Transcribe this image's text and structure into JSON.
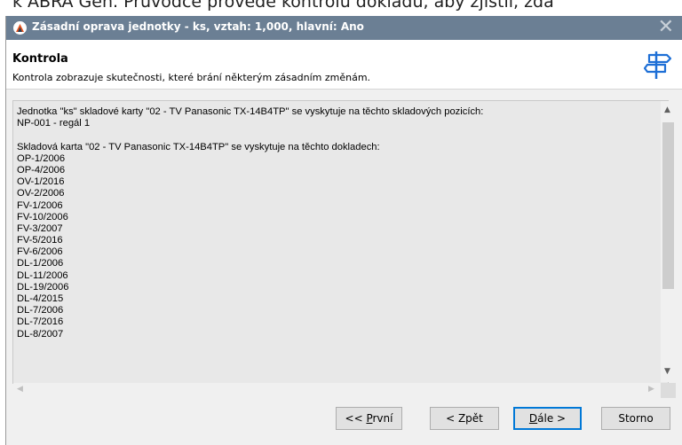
{
  "background_text": "k ABRA Gen. Průvodce provede kontrolu dokladu, aby zjistil, zda",
  "window": {
    "title": "Zásadní oprava jednotky - ks, vztah: 1,000, hlavní: Ano",
    "close_glyph": "✕"
  },
  "header": {
    "title": "Kontrola",
    "subtitle": "Kontrola zobrazuje skutečnosti, které brání některým zásadním změnám."
  },
  "content": {
    "lines": [
      "Jednotka \"ks\" skladové karty \"02 - TV Panasonic TX-14B4TP\" se vyskytuje na těchto skladových pozicích:",
      "NP-001 - regál 1",
      "",
      "Skladová karta \"02 - TV Panasonic TX-14B4TP\" se vyskytuje na těchto dokladech:",
      "OP-1/2006",
      "OP-4/2006",
      "OV-1/2016",
      "OV-2/2006",
      "FV-1/2006",
      "FV-10/2006",
      "FV-3/2007",
      "FV-5/2016",
      "FV-6/2006",
      "DL-1/2006",
      "DL-11/2006",
      "DL-19/2006",
      "DL-4/2015",
      "DL-7/2006",
      "DL-7/2016",
      "DL-8/2007"
    ]
  },
  "scrollbar": {
    "up": "▲",
    "down": "▼",
    "left": "◀",
    "right": "▶"
  },
  "buttons": {
    "first": {
      "prefix": "<< ",
      "accel": "P",
      "rest": "rvní"
    },
    "back": {
      "prefix": "< Zpět",
      "accel": "",
      "rest": ""
    },
    "next": {
      "prefix": "",
      "accel": "D",
      "rest": "ále >"
    },
    "cancel": {
      "prefix": "Storno",
      "accel": "",
      "rest": ""
    }
  },
  "colors": {
    "titlebar": "#6b7f94",
    "focus": "#0078d7",
    "signpost": "#1e6fd6",
    "app_icon": "#e8541e"
  },
  "icons": {
    "app": "abra-logo-icon",
    "header": "signpost-icon",
    "close": "close-icon"
  }
}
